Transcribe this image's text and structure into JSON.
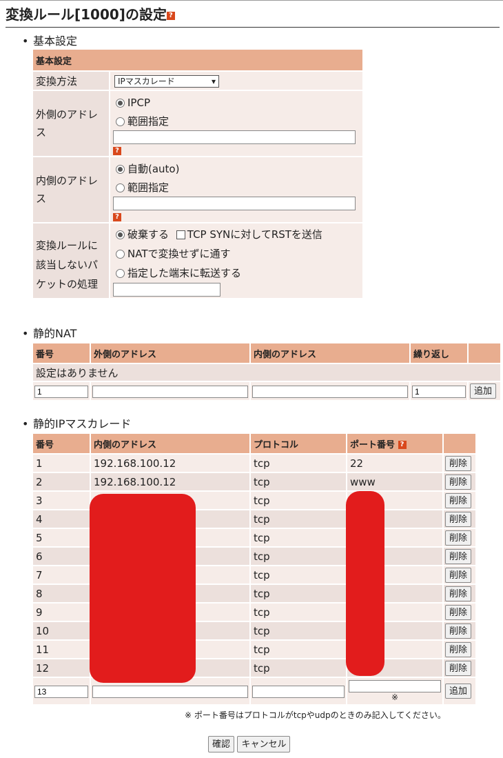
{
  "title": "変換ルール[1000]の設定",
  "help_glyph": "?",
  "basic": {
    "section_label": "基本設定",
    "table_header": "基本設定",
    "method_label": "変換方法",
    "method_value": "IPマスカレード",
    "outer_label": "外側のアドレス",
    "outer_opt1": "IPCP",
    "outer_opt2": "範囲指定",
    "inner_label": "内側のアドレス",
    "inner_opt1": "自動(auto)",
    "inner_opt2": "範囲指定",
    "nomatch_label": "変換ルールに該当しないパケットの処理",
    "nomatch_opt1": "破棄する",
    "nomatch_check": "TCP SYNに対してRSTを送信",
    "nomatch_opt2": "NATで変換せずに通す",
    "nomatch_opt3": "指定した端末に転送する"
  },
  "static_nat": {
    "section_label": "静的NAT",
    "headers": [
      "番号",
      "外側のアドレス",
      "内側のアドレス",
      "繰り返し"
    ],
    "empty_text": "設定はありません",
    "new_number": "1",
    "new_repeat": "1",
    "add_label": "追加"
  },
  "masq": {
    "section_label": "静的IPマスカレード",
    "headers": [
      "番号",
      "内側のアドレス",
      "プロトコル",
      "ポート番号"
    ],
    "rows": [
      {
        "num": "1",
        "addr": "192.168.100.12",
        "proto": "tcp",
        "port": "22"
      },
      {
        "num": "2",
        "addr": "192.168.100.12",
        "proto": "tcp",
        "port": "www"
      },
      {
        "num": "3",
        "addr": "",
        "proto": "tcp",
        "port": ""
      },
      {
        "num": "4",
        "addr": "",
        "proto": "tcp",
        "port": ""
      },
      {
        "num": "5",
        "addr": "",
        "proto": "tcp",
        "port": ""
      },
      {
        "num": "6",
        "addr": "",
        "proto": "tcp",
        "port": ""
      },
      {
        "num": "7",
        "addr": "",
        "proto": "tcp",
        "port": ""
      },
      {
        "num": "8",
        "addr": "",
        "proto": "tcp",
        "port": ""
      },
      {
        "num": "9",
        "addr": "",
        "proto": "tcp",
        "port": ""
      },
      {
        "num": "10",
        "addr": "",
        "proto": "tcp",
        "port": ""
      },
      {
        "num": "11",
        "addr": "",
        "proto": "tcp",
        "port": ""
      },
      {
        "num": "12",
        "addr": "",
        "proto": "tcp",
        "port": ""
      }
    ],
    "delete_label": "削除",
    "new_number": "13",
    "port_mark": "※",
    "add_label": "追加",
    "note": "※ ポート番号はプロトコルがtcpやudpのときのみ記入してください。"
  },
  "footer": {
    "confirm_label": "確認",
    "cancel_label": "キャンセル"
  },
  "colors": {
    "header_bg": "#e8ad8f",
    "row_light": "#f6ece8",
    "row_dark": "#ece0dc",
    "redaction": "#e21c1c"
  }
}
